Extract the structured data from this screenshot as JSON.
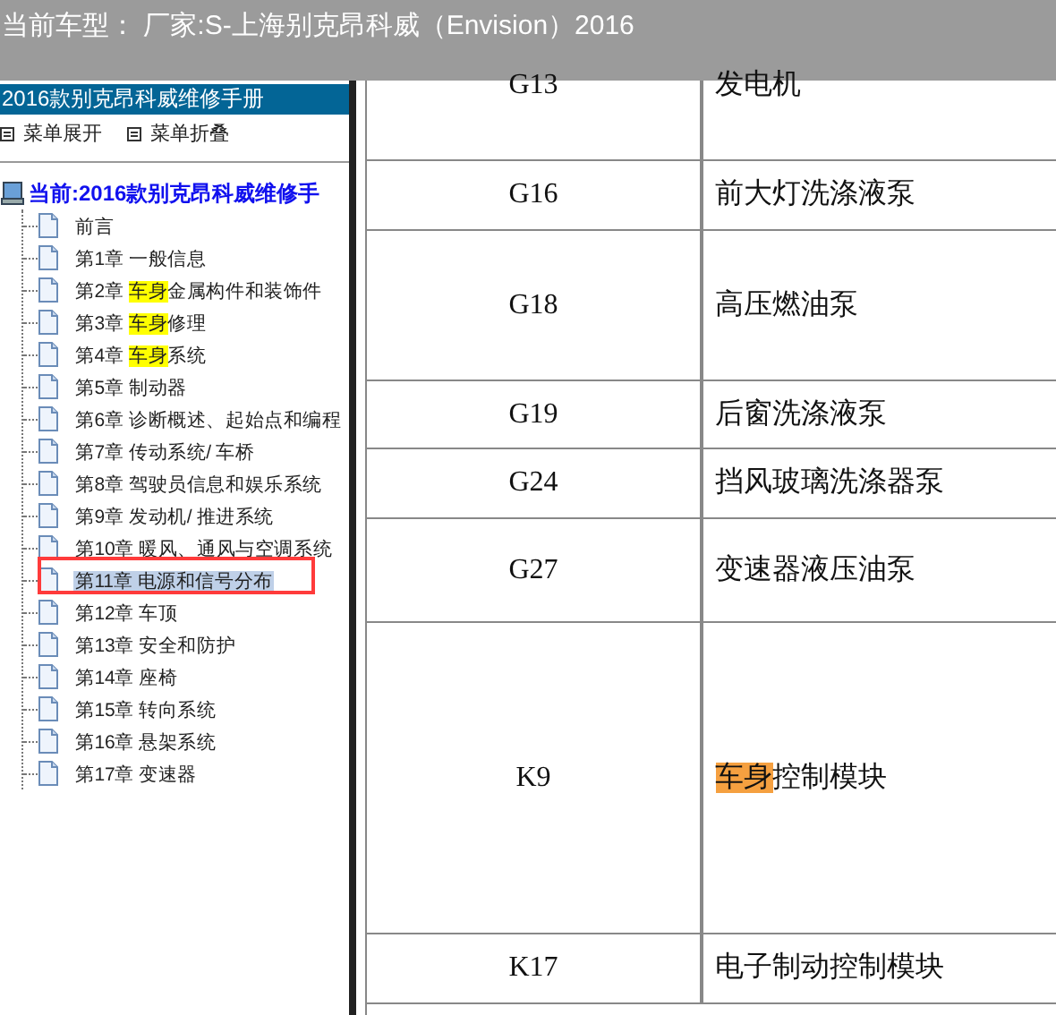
{
  "title": "当前车型： 厂家:S-上海别克昂科威（Envision）2016",
  "sidebar": {
    "header": "2016款别克昂科威维修手册",
    "menu_buttons": [
      "菜单展开",
      "菜单折叠"
    ],
    "tree": {
      "label": "当前:2016款别克昂科威维修手",
      "children": [
        {
          "before": "前言",
          "selected": false,
          "annotated": false
        },
        {
          "before": "第1章 一般信息",
          "selected": false,
          "annotated": false
        },
        {
          "before": "第2章 ",
          "marked": "车身",
          "after": "金属构件和装饰件",
          "selected": false,
          "annotated": false
        },
        {
          "before": "第3章 ",
          "marked": "车身",
          "after": "修理",
          "selected": false,
          "annotated": false
        },
        {
          "before": "第4章 ",
          "marked": "车身",
          "after": "系统",
          "selected": false,
          "annotated": false
        },
        {
          "before": "第5章 制动器",
          "selected": false,
          "annotated": false
        },
        {
          "before": "第6章 诊断概述、起始点和编程",
          "selected": false,
          "annotated": false
        },
        {
          "before": "第7章 传动系统/ 车桥",
          "selected": false,
          "annotated": false
        },
        {
          "before": "第8章 驾驶员信息和娱乐系统",
          "selected": false,
          "annotated": false
        },
        {
          "before": "第9章 发动机/ 推进系统",
          "selected": false,
          "annotated": false
        },
        {
          "before": "第10章 暖风、通风与空调系统",
          "selected": false,
          "annotated": false
        },
        {
          "before": "第11章 电源和信号分布",
          "selected": true,
          "annotated": true
        },
        {
          "before": "第12章 车顶",
          "selected": false,
          "annotated": false
        },
        {
          "before": "第13章 安全和防护",
          "selected": false,
          "annotated": false
        },
        {
          "before": "第14章 座椅",
          "selected": false,
          "annotated": false
        },
        {
          "before": "第15章 转向系统",
          "selected": false,
          "annotated": false
        },
        {
          "before": "第16章 悬架系统",
          "selected": false,
          "annotated": false
        },
        {
          "before": "第17章 变速器",
          "selected": false,
          "annotated": false
        }
      ]
    }
  },
  "table": {
    "rows": [
      {
        "code": "G13",
        "name": "发电机"
      },
      {
        "code": "G16",
        "name": "前大灯洗涤液泵"
      },
      {
        "code": "G18",
        "name": "高压燃油泵"
      },
      {
        "code": "G19",
        "name": "后窗洗涤液泵"
      },
      {
        "code": "G24",
        "name": "挡风玻璃洗涤器泵"
      },
      {
        "code": "G27",
        "name": "变速器液压油泵"
      },
      {
        "code": "K9",
        "marked": "车身",
        "name": "控制模块"
      },
      {
        "code": "K17",
        "name": "电子制动控制模块"
      }
    ]
  }
}
